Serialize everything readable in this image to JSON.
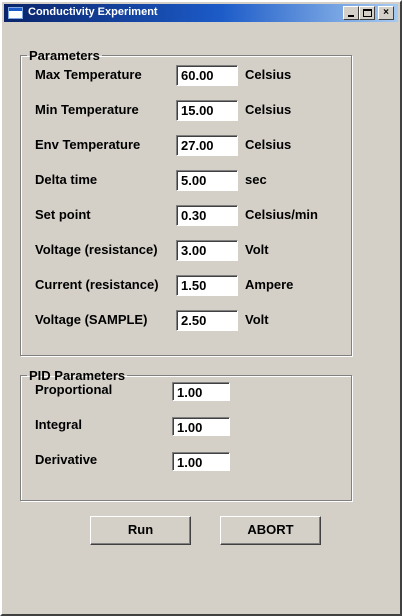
{
  "window": {
    "title": "Conductivity Experiment",
    "controls": {
      "minimize": "_",
      "maximize": "□",
      "close": "×"
    }
  },
  "parameters": {
    "legend": "Parameters",
    "rows": [
      {
        "label": "Max Temperature",
        "value": "60.00",
        "unit": "Celsius"
      },
      {
        "label": "Min Temperature",
        "value": "15.00",
        "unit": "Celsius"
      },
      {
        "label": "Env Temperature",
        "value": "27.00",
        "unit": "Celsius"
      },
      {
        "label": "Delta time",
        "value": "5.00",
        "unit": "sec"
      },
      {
        "label": "Set point",
        "value": "0.30",
        "unit": "Celsius/min"
      },
      {
        "label": "Voltage (resistance)",
        "value": "3.00",
        "unit": "Volt"
      },
      {
        "label": "Current (resistance)",
        "value": "1.50",
        "unit": "Ampere"
      },
      {
        "label": "Voltage (SAMPLE)",
        "value": "2.50",
        "unit": "Volt"
      }
    ]
  },
  "pid": {
    "legend": "PID Parameters",
    "rows": [
      {
        "label": "Proportional",
        "value": "1.00"
      },
      {
        "label": "Integral",
        "value": "1.00"
      },
      {
        "label": "Derivative",
        "value": "1.00"
      }
    ]
  },
  "buttons": {
    "run": "Run",
    "abort": "ABORT"
  }
}
